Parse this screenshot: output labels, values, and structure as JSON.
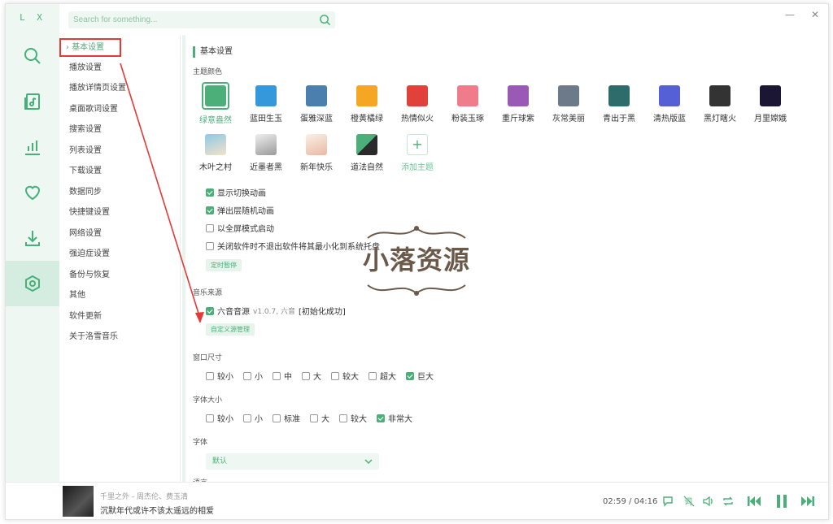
{
  "app": {
    "logo": "L X"
  },
  "search": {
    "placeholder": "Search for something..."
  },
  "window": {
    "minimize": "—",
    "close": "✕"
  },
  "rail": {
    "items": [
      {
        "name": "search-icon"
      },
      {
        "name": "music-list-icon"
      },
      {
        "name": "chart-icon"
      },
      {
        "name": "heart-icon"
      },
      {
        "name": "download-icon"
      },
      {
        "name": "settings-icon",
        "active": true
      }
    ]
  },
  "nav": {
    "items": [
      "基本设置",
      "播放设置",
      "播放详情页设置",
      "桌面歌词设置",
      "搜索设置",
      "列表设置",
      "下载设置",
      "数据同步",
      "快捷键设置",
      "网络设置",
      "强迫症设置",
      "备份与恢复",
      "其他",
      "软件更新",
      "关于洛雪音乐"
    ],
    "active_prefix": "›"
  },
  "content": {
    "section_title": "基本设置",
    "theme_label": "主题颜色",
    "themes_row1": [
      {
        "label": "绿意盎然",
        "color": "#4caf7a",
        "active": true
      },
      {
        "label": "蓝田生玉",
        "color": "#3498db"
      },
      {
        "label": "蛋雅深蓝",
        "color": "#4a7fae"
      },
      {
        "label": "橙黄橘绿",
        "color": "#f5a623"
      },
      {
        "label": "热情似火",
        "color": "#e0413b"
      },
      {
        "label": "粉装玉琢",
        "color": "#f07b8a"
      },
      {
        "label": "重斤球紫",
        "color": "#9b59b6"
      },
      {
        "label": "灰常美丽",
        "color": "#6c7a89"
      },
      {
        "label": "青出于黑",
        "color": "#2e6b6b"
      },
      {
        "label": "清热版蓝",
        "color": "#5660d6"
      },
      {
        "label": "黑灯瞎火",
        "color": "#333333"
      },
      {
        "label": "月里嫦娥",
        "color": "#1b1633"
      }
    ],
    "themes_row2": [
      {
        "label": "木叶之村",
        "color": "#8ec9e6"
      },
      {
        "label": "近墨者黑",
        "color": "#cfcfcf"
      },
      {
        "label": "新年快乐",
        "color": "#f4e3d7"
      },
      {
        "label": "道法自然",
        "color": "#3b7d5a"
      }
    ],
    "theme_add": {
      "symbol": "+",
      "label": "添加主题"
    },
    "checkboxes": [
      {
        "label": "显示切换动画",
        "checked": true
      },
      {
        "label": "弹出层随机动画",
        "checked": true
      },
      {
        "label": "以全屏模式启动",
        "checked": false
      },
      {
        "label": "关闭软件时不退出软件将其最小化到系统托盘",
        "checked": false
      }
    ],
    "timer_button": "定时暂停",
    "source_label": "音乐来源",
    "source": {
      "name": "六音音源",
      "version": "v1.0.7, 六音",
      "status": "[初始化成功]",
      "checked": true
    },
    "custom_source_button": "自定义源管理",
    "window_size_label": "窗口尺寸",
    "window_sizes": [
      {
        "label": "较小",
        "checked": false
      },
      {
        "label": "小",
        "checked": false
      },
      {
        "label": "中",
        "checked": false
      },
      {
        "label": "大",
        "checked": false
      },
      {
        "label": "较大",
        "checked": false
      },
      {
        "label": "超大",
        "checked": false
      },
      {
        "label": "巨大",
        "checked": true
      }
    ],
    "font_size_label": "字体大小",
    "font_sizes": [
      {
        "label": "较小",
        "checked": false
      },
      {
        "label": "小",
        "checked": false
      },
      {
        "label": "标准",
        "checked": false
      },
      {
        "label": "大",
        "checked": false
      },
      {
        "label": "较大",
        "checked": false
      },
      {
        "label": "非常大",
        "checked": true
      }
    ],
    "font_label": "字体",
    "font_value": "默认",
    "next_label_partial": "语言"
  },
  "watermark": {
    "text": "小落资源"
  },
  "player": {
    "title": "千里之外 - 周杰伦、费玉清",
    "lyric": "沉默年代或许不该太遥远的相爱",
    "time": "02:59 / 04:16"
  },
  "colors": {
    "accent": "#4caf7a",
    "annotation": "#e53935"
  }
}
